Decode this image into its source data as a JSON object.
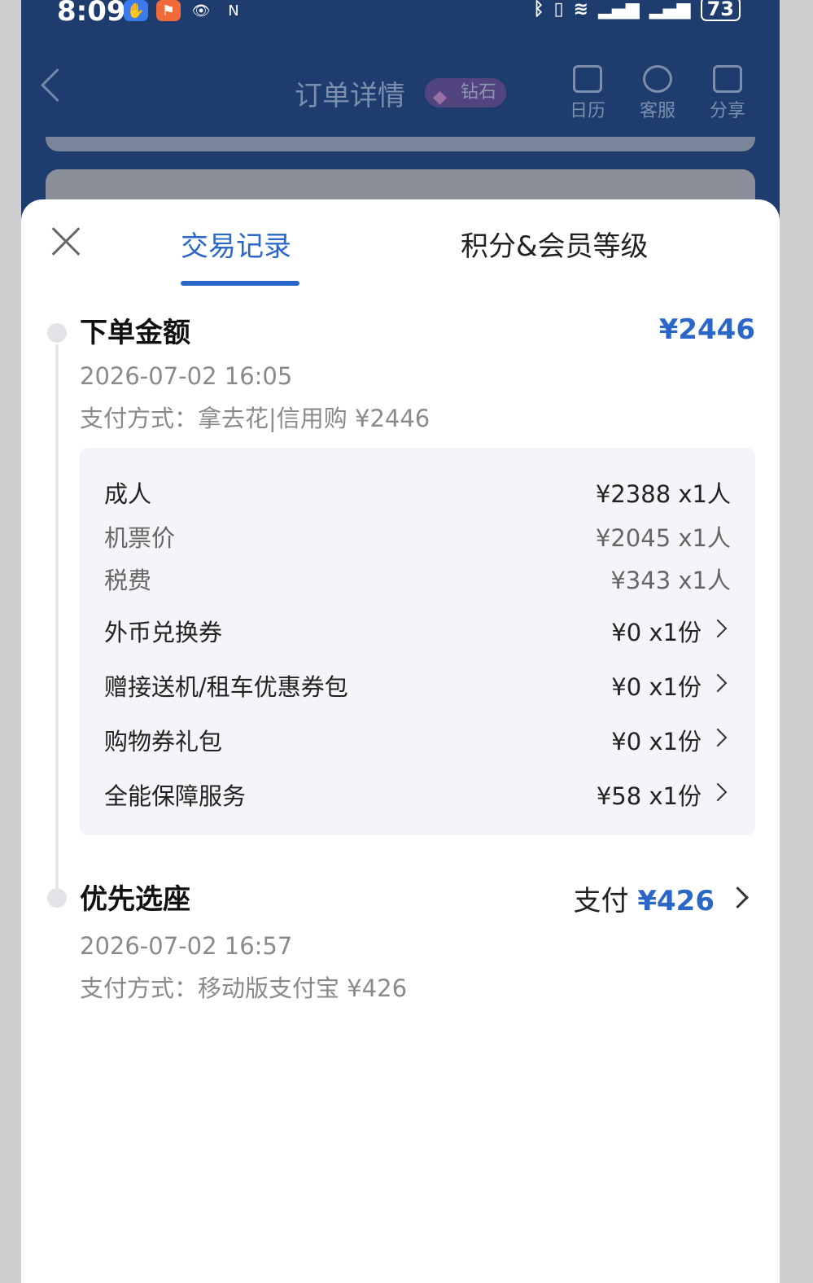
{
  "status_bar": {
    "time": "8:09",
    "battery": "73",
    "icons": [
      "app-shield-icon",
      "app-runner-icon",
      "eye-icon",
      "nfc-icon",
      "bluetooth-icon",
      "vibrate-icon",
      "wifi-icon",
      "signal-icon",
      "signal-icon"
    ]
  },
  "header": {
    "title": "订单详情",
    "badge": "钻石",
    "actions": [
      {
        "label": "日历",
        "icon": "calendar-icon"
      },
      {
        "label": "客服",
        "icon": "headset-icon"
      },
      {
        "label": "分享",
        "icon": "share-icon"
      }
    ]
  },
  "sheet": {
    "tabs": [
      {
        "label": "交易记录",
        "active": true
      },
      {
        "label": "积分&会员等级",
        "active": false
      }
    ],
    "order": {
      "title": "下单金额",
      "amount": "¥2446",
      "time": "2026-07-02 16:05",
      "payment": "支付方式：拿去花|信用购 ¥2446",
      "items": [
        {
          "label": "成人",
          "value": "¥2388 x1人",
          "sub": false,
          "arrow": false
        },
        {
          "label": "机票价",
          "value": "¥2045 x1人",
          "sub": true,
          "arrow": false
        },
        {
          "label": "税费",
          "value": "¥343 x1人",
          "sub": true,
          "arrow": false
        },
        {
          "label": "外币兑换券",
          "value": "¥0 x1份",
          "sub": false,
          "arrow": true
        },
        {
          "label": "赠接送机/租车优惠券包",
          "value": "¥0 x1份",
          "sub": false,
          "arrow": true
        },
        {
          "label": "购物券礼包",
          "value": "¥0 x1份",
          "sub": false,
          "arrow": true
        },
        {
          "label": "全能保障服务",
          "value": "¥58 x1份",
          "sub": false,
          "arrow": true
        }
      ]
    },
    "seat": {
      "title": "优先选座",
      "pay_label": "支付",
      "pay_amount": "¥426",
      "time": "2026-07-02 16:57",
      "payment": "支付方式：移动版支付宝 ¥426"
    }
  },
  "colors": {
    "accent": "#2b67c9",
    "header_bg": "#1e3d6e",
    "panel_bg": "#f4f5f8"
  }
}
